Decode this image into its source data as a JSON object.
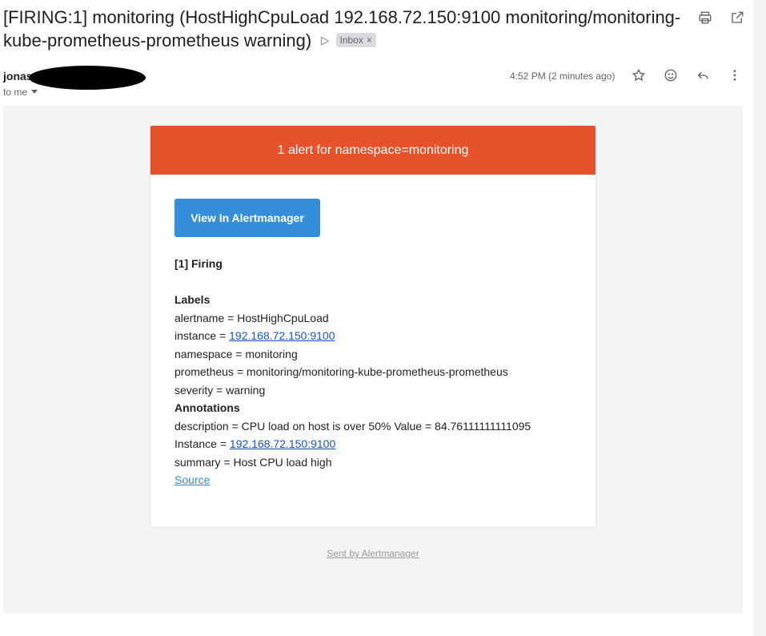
{
  "subject": {
    "text": "[FIRING:1] monitoring (HostHighCpuLoad 192.168.72.150:9100 monitoring/monitoring-kube-prometheus-prometheus warning)",
    "importance_icon": "important-marker-icon",
    "label": "Inbox",
    "label_remove": "×"
  },
  "top_icons": [
    "print-icon",
    "open-in-new-window-icon"
  ],
  "message": {
    "sender_name": "jonas",
    "recipient": "to me",
    "date": "4:52 PM (2 minutes ago)",
    "icons": [
      "star-icon",
      "emoji-icon",
      "reply-icon",
      "more-vert-icon"
    ]
  },
  "alert": {
    "header": "1 alert for namespace=monitoring",
    "button_label": "View In Alertmanager",
    "status": "[1] Firing",
    "labels_heading": "Labels",
    "labels": [
      {
        "key": "alertname",
        "sep": " = ",
        "value": "HostHighCpuLoad"
      },
      {
        "key": "instance",
        "sep": " = ",
        "value": "192.168.72.150:9100"
      },
      {
        "key": "namespace",
        "sep": " = ",
        "value": "monitoring"
      },
      {
        "key": "prometheus",
        "sep": " = ",
        "value": "monitoring/monitoring-kube-prometheus-prometheus"
      },
      {
        "key": "severity",
        "sep": " = ",
        "value": "warning"
      }
    ],
    "annotations_heading": "Annotations",
    "annotations": [
      {
        "key": "description",
        "sep": " = ",
        "value": "CPU load on host is over 50% Value = 84.76111111111095"
      },
      {
        "key": "Instance",
        "sep": " = ",
        "value": "192.168.72.150:9100"
      },
      {
        "key": "summary",
        "sep": " = ",
        "value": "Host CPU load high"
      }
    ],
    "source_link": "Source",
    "footer": "Sent by Alertmanager"
  },
  "colors": {
    "header_bg": "#e6522c",
    "button_bg": "#348eda",
    "link": "#1155cc",
    "email_bg": "#f4f4f4"
  }
}
